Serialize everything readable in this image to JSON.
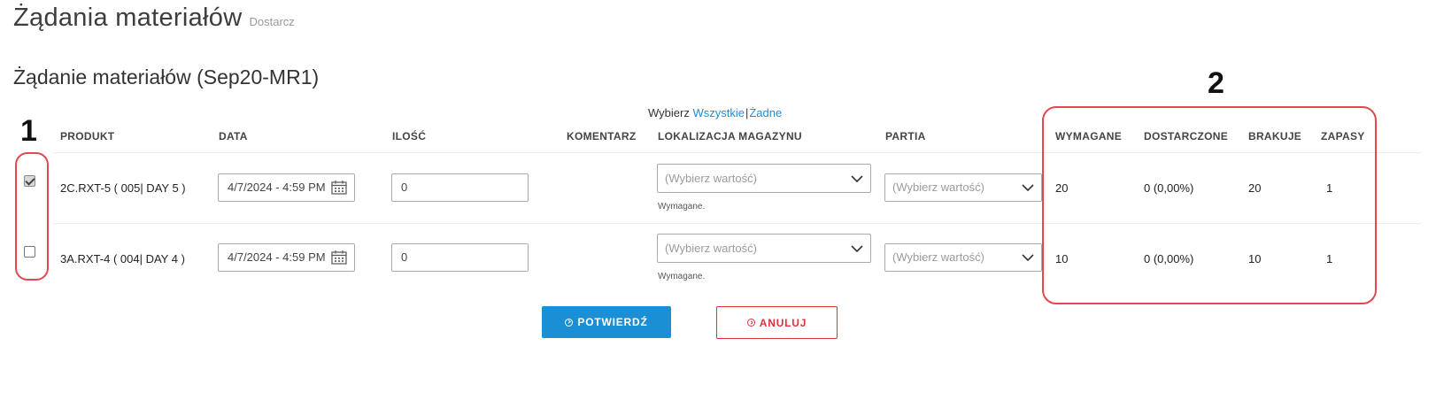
{
  "header": {
    "title": "Żądania materiałów",
    "subtitle": "Dostarcz"
  },
  "section": {
    "title": "Żądanie materiałów (Sep20-MR1)"
  },
  "select_all": {
    "prefix": "Wybierz",
    "all": "Wszystkie",
    "separator": "|",
    "none": "Żadne"
  },
  "columns": {
    "product": "PRODUKT",
    "date": "DATA",
    "quantity": "ILOŚĆ",
    "comment": "KOMENTARZ",
    "location": "LOKALIZACJA MAGAZYNU",
    "batch": "PARTIA",
    "required": "WYMAGANE",
    "delivered": "DOSTARCZONE",
    "missing": "BRAKUJE",
    "stock": "ZAPASY"
  },
  "rows": [
    {
      "checked": true,
      "product": "2C.RXT-5 ( 005| DAY 5 )",
      "date": "4/7/2024 - 4:59 PM",
      "quantity": "0",
      "location_placeholder": "(Wybierz wartość)",
      "location_hint": "Wymagane.",
      "batch_placeholder": "(Wybierz wartość)",
      "required": "20",
      "delivered": "0 (0,00%)",
      "missing": "20",
      "stock": "1"
    },
    {
      "checked": false,
      "product": "3A.RXT-4 ( 004| DAY 4 )",
      "date": "4/7/2024 - 4:59 PM",
      "quantity": "0",
      "location_placeholder": "(Wybierz wartość)",
      "location_hint": "Wymagane.",
      "batch_placeholder": "(Wybierz wartość)",
      "required": "10",
      "delivered": "0 (0,00%)",
      "missing": "10",
      "stock": "1"
    }
  ],
  "buttons": {
    "confirm": "POTWIERDŹ",
    "cancel": "ANULUJ"
  },
  "annotations": {
    "marker1": "1",
    "marker2": "2"
  },
  "icons": {
    "calendar": "calendar-icon",
    "dropdown": "chevron-down-icon",
    "confirm": "check-circle-icon",
    "cancel": "check-circle-icon"
  },
  "colors": {
    "accent": "#1a8fd6",
    "danger": "#e0303a",
    "annotation": "#e4474f"
  }
}
